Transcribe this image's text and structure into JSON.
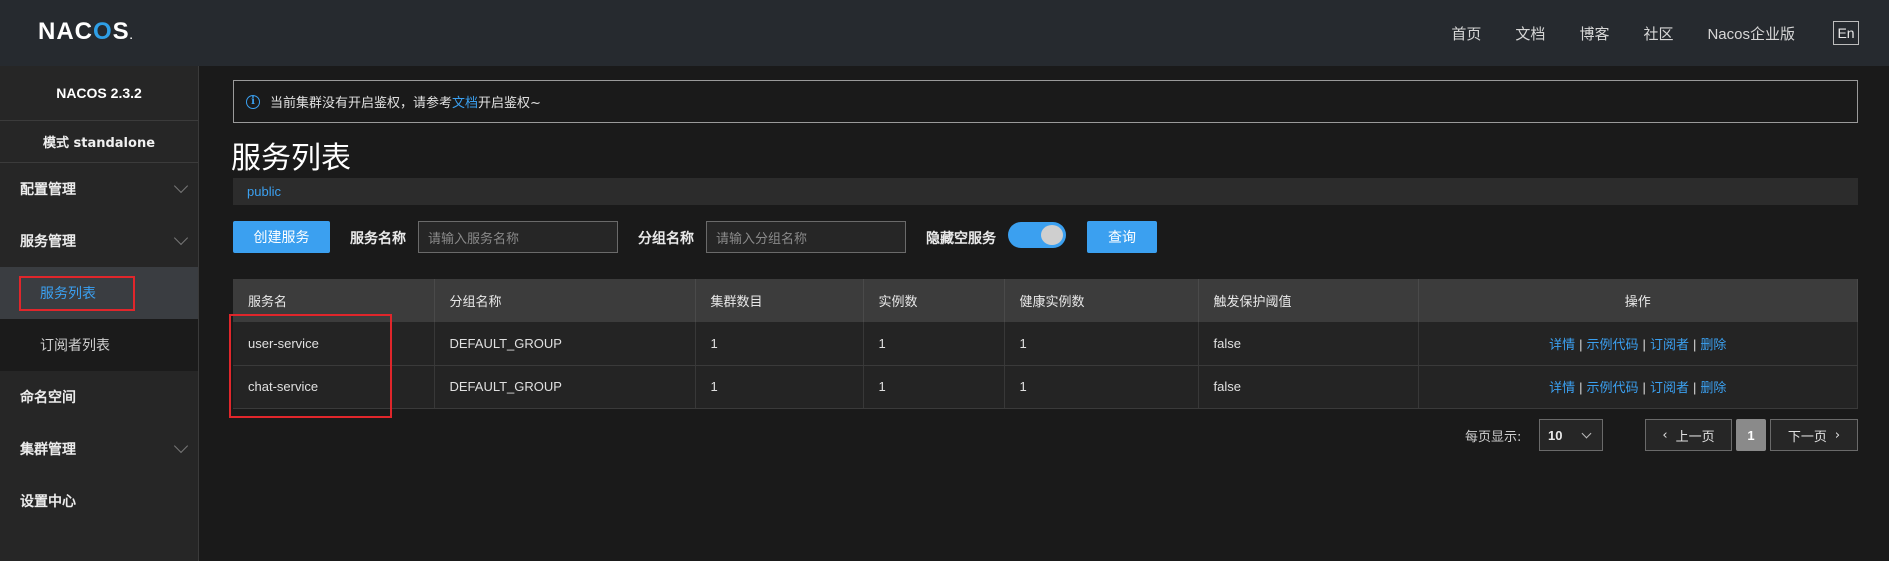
{
  "header": {
    "logo": {
      "part1": "NAC",
      "part2": "O",
      "part3": "S",
      "dot": "."
    },
    "nav": [
      "首页",
      "文档",
      "博客",
      "社区",
      "Nacos企业版"
    ],
    "lang": "En"
  },
  "sidebar": {
    "version": "NACOS 2.3.2",
    "mode": "模式 standalone",
    "items": [
      {
        "label": "配置管理"
      },
      {
        "label": "服务管理"
      },
      {
        "label": "服务列表"
      },
      {
        "label": "订阅者列表"
      },
      {
        "label": "命名空间"
      },
      {
        "label": "集群管理"
      },
      {
        "label": "设置中心"
      }
    ]
  },
  "notice": {
    "text1": "当前集群没有开启鉴权，请参考",
    "link": "文档",
    "text2": "开启鉴权~"
  },
  "main": {
    "title": "服务列表",
    "namespace": "public",
    "create_button": "创建服务",
    "service_name_label": "服务名称",
    "service_name_placeholder": "请输入服务名称",
    "group_name_label": "分组名称",
    "group_name_placeholder": "请输入分组名称",
    "hide_empty_label": "隐藏空服务",
    "query_button": "查询"
  },
  "table": {
    "headers": [
      "服务名",
      "分组名称",
      "集群数目",
      "实例数",
      "健康实例数",
      "触发保护阈值",
      "操作"
    ],
    "rows": [
      {
        "name": "user-service",
        "group": "DEFAULT_GROUP",
        "clusters": "1",
        "instances": "1",
        "healthy": "1",
        "threshold": "false"
      },
      {
        "name": "chat-service",
        "group": "DEFAULT_GROUP",
        "clusters": "1",
        "instances": "1",
        "healthy": "1",
        "threshold": "false"
      }
    ],
    "ops": [
      "详情",
      "示例代码",
      "订阅者",
      "删除"
    ],
    "op_separator": "|"
  },
  "pagination": {
    "page_size_label": "每页显示:",
    "page_size": "10",
    "prev": "上一页",
    "current": "1",
    "next": "下一页"
  },
  "colors": {
    "accent": "#3ba0f0",
    "highlight": "#e0262b"
  }
}
